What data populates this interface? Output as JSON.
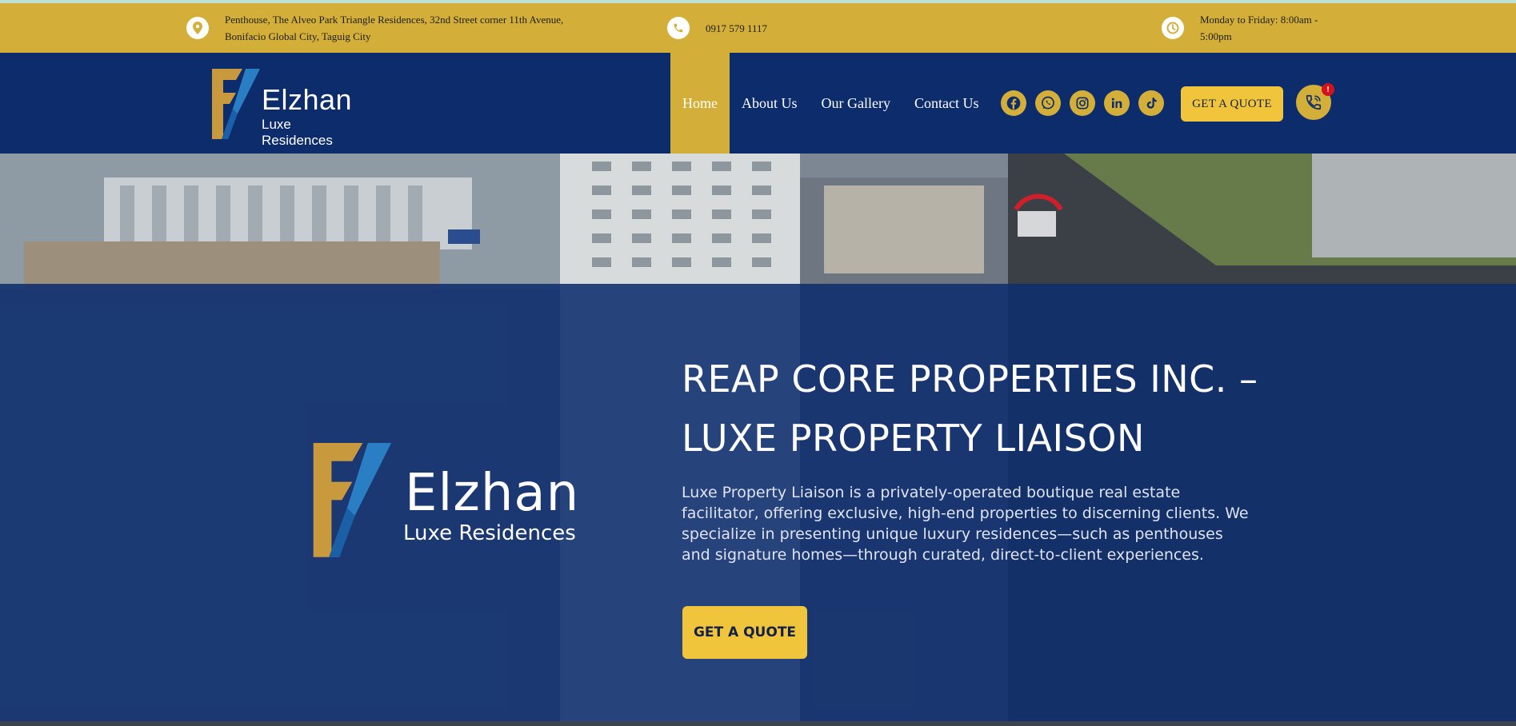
{
  "colors": {
    "gold": "#d3af3a",
    "navy": "#0d2c6b",
    "button_yellow": "#f0c43b",
    "badge_red": "#d4121b"
  },
  "info_bar": {
    "address_line1": "Penthouse, The Alveo Park Triangle Residences, 32nd Street corner 11th Avenue,",
    "address_line2": "Bonifacio Global City, Taguig City",
    "phone": "0917 579 1117",
    "hours_line1": "Monday to Friday: 8:00am -",
    "hours_line2": "5:00pm",
    "icons": [
      "map-pin-icon",
      "phone-icon",
      "clock-icon"
    ]
  },
  "brand": {
    "name": "Elzhan",
    "tagline": "Luxe Residences"
  },
  "nav": {
    "items": [
      {
        "label": "Home",
        "active": true
      },
      {
        "label": "About Us",
        "active": false
      },
      {
        "label": "Our Gallery",
        "active": false
      },
      {
        "label": "Contact Us",
        "active": false
      }
    ],
    "social": [
      "facebook-icon",
      "whatsapp-icon",
      "instagram-icon",
      "linkedin-icon",
      "tiktok-icon"
    ],
    "quote_label": "GET A QUOTE",
    "phone_badge": "!"
  },
  "hero": {
    "title_line1": "REAP CORE PROPERTIES INC. –",
    "title_line2": "LUXE PROPERTY LIAISON",
    "desc_line1": "Luxe Property Liaison is a privately-operated boutique real estate",
    "desc_line2": "facilitator, offering exclusive, high-end properties to discerning clients. We",
    "desc_line3": "specialize in presenting unique luxury residences—such as penthouses",
    "desc_line4": "and signature homes—through curated, direct-to-client experiences.",
    "button_label": "GET A QUOTE"
  }
}
